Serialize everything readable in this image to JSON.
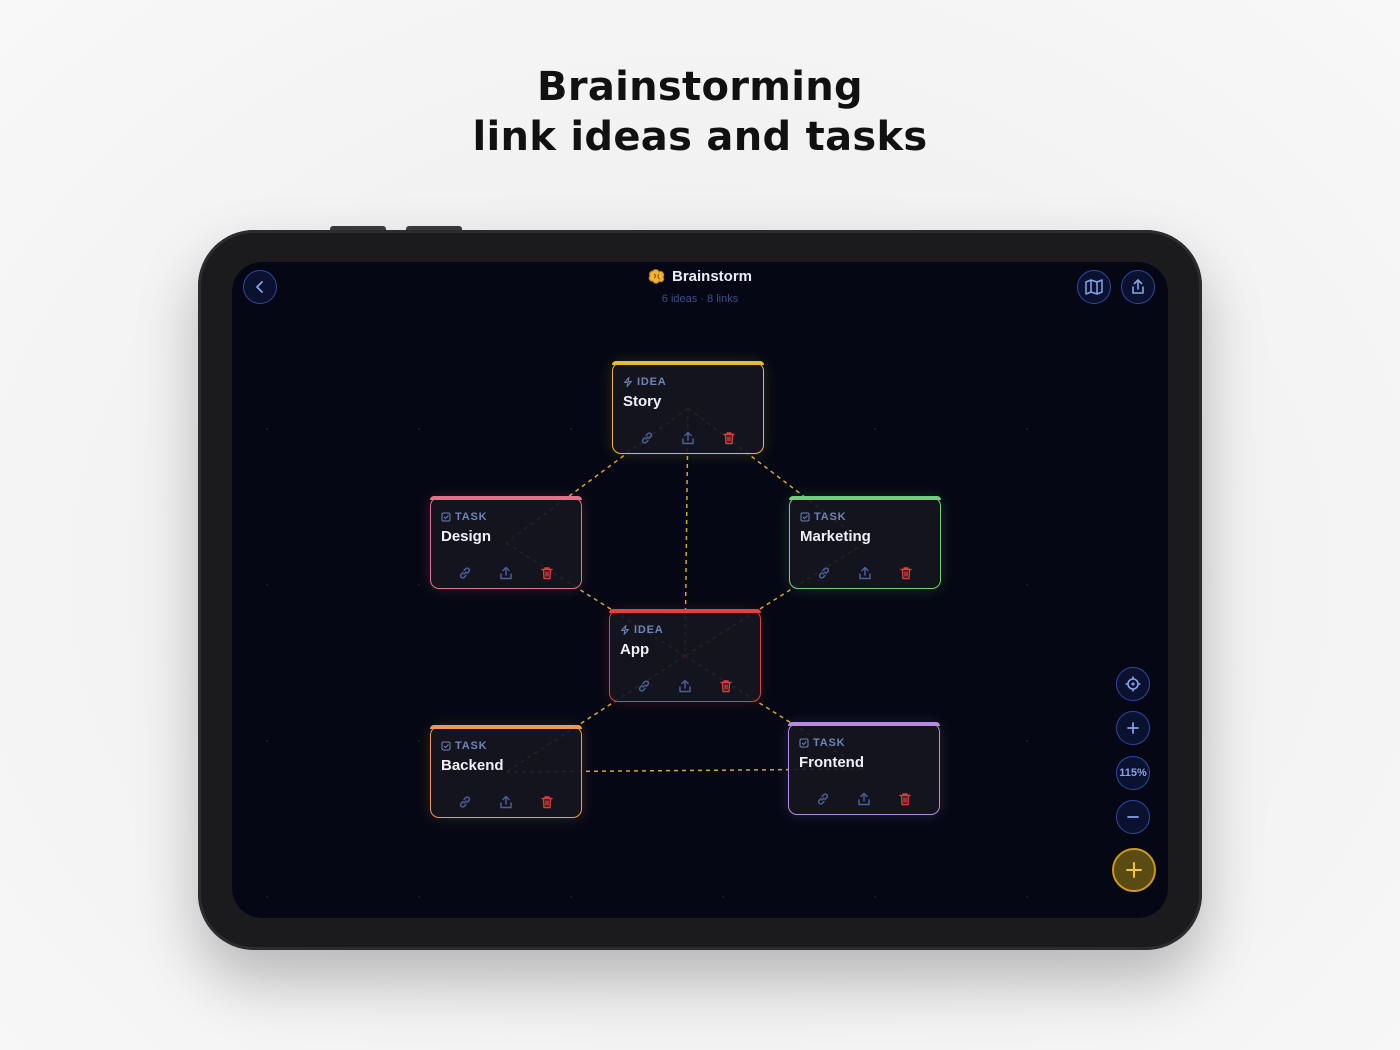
{
  "headline": {
    "line1": "Brainstorming",
    "line2": "link ideas and tasks"
  },
  "header": {
    "title": "Brainstorm",
    "subtitle": "6 ideas · 8 links",
    "back_icon": "chevron-left-icon",
    "title_icon": "brain-icon",
    "map_icon": "map-icon",
    "share_icon": "share-icon"
  },
  "nodes": [
    {
      "id": "story",
      "kind": "IDEA",
      "name": "Story",
      "color": "#e8b93a"
    },
    {
      "id": "design",
      "kind": "TASK",
      "name": "Design",
      "color": "#e5708a"
    },
    {
      "id": "marketing",
      "kind": "TASK",
      "name": "Marketing",
      "color": "#6fcf7e"
    },
    {
      "id": "app",
      "kind": "IDEA",
      "name": "App",
      "color": "#e0423c"
    },
    {
      "id": "backend",
      "kind": "TASK",
      "name": "Backend",
      "color": "#ef9a4e"
    },
    {
      "id": "frontend",
      "kind": "TASK",
      "name": "Frontend",
      "color": "#b58be0"
    }
  ],
  "links": [
    [
      "story",
      "design"
    ],
    [
      "story",
      "marketing"
    ],
    [
      "story",
      "app"
    ],
    [
      "design",
      "app"
    ],
    [
      "marketing",
      "app"
    ],
    [
      "app",
      "backend"
    ],
    [
      "app",
      "frontend"
    ],
    [
      "backend",
      "frontend"
    ]
  ],
  "colors": {
    "link": "#d9a52a",
    "accent_blue": "#2c4a9e",
    "fab": "#e0b227",
    "delete": "#d6403a"
  },
  "controls": {
    "recenter_icon": "crosshair-icon",
    "zoom_in_icon": "plus-icon",
    "zoom_level": "115%",
    "zoom_out_icon": "minus-icon",
    "add_icon": "plus-icon"
  }
}
